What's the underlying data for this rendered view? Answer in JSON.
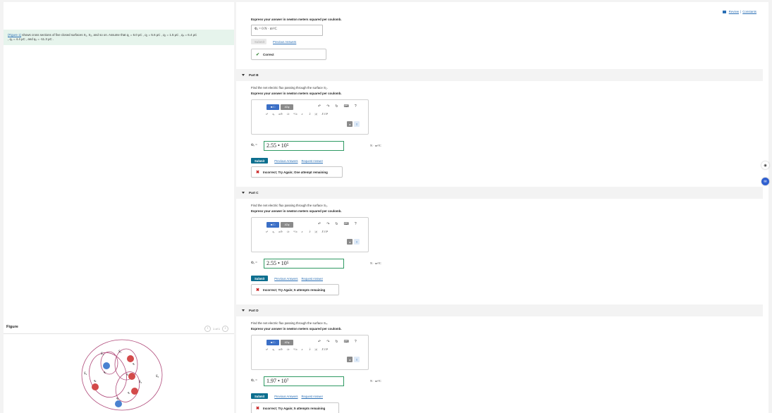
{
  "top_links": {
    "review": "Review",
    "separator": "|",
    "constants": "Constants"
  },
  "problem": {
    "link": "(Figure 1)",
    "text": " shows cross sections of five closed surfaces S₁, S₂, and so on. Assume that q₁ = 6.0 μC , q₂ = 5.6 μC , q₃ = 1.5 μC , q₄ = 6.4 μC",
    "text2": ", q₅ = 4.4 μC , and q₆ = -11.3 μC ."
  },
  "figure": {
    "label": "Figure",
    "pager": "1 of 1",
    "surfaces": [
      "S₁",
      "S₂",
      "S₃",
      "S₄",
      "S₅"
    ],
    "charges": [
      "q₁",
      "q₂",
      "q₃",
      "q₄",
      "q₅",
      "q₆"
    ]
  },
  "part_a": {
    "express": "Express your answer in newton meters squared per coulomb.",
    "answer": "Φₑ = 0  N · m²/C",
    "submit": "Submit",
    "previous": "Previous Answers",
    "feedback": "Correct"
  },
  "part_b": {
    "title": "Part B",
    "question": "Find the net electric flux passing through the surface S₂.",
    "express": "Express your answer in newton meters squared per coulomb.",
    "phi_label": "Φₑ =",
    "value": "2.55 • 10⁵",
    "unit": "N · m²/C",
    "submit": "Submit",
    "previous": "Previous Answers",
    "request": "Request Answer",
    "feedback": "Incorrect; Try Again; One attempt remaining"
  },
  "part_c": {
    "title": "Part C",
    "question": "Find the net electric flux passing through the surface S₃.",
    "express": "Express your answer in newton meters squared per coulomb.",
    "phi_label": "Φₑ =",
    "value": "2.55 • 10⁵",
    "unit": "N · m²/C",
    "submit": "Submit",
    "previous": "Previous Answers",
    "request": "Request Answer",
    "feedback": "Incorrect; Try Again; 5 attempts remaining"
  },
  "part_d": {
    "title": "Part D",
    "question": "Find the net electric flux passing through the surface S₄.",
    "express": "Express your answer in newton meters squared per coulomb.",
    "phi_label": "Φₑ =",
    "value": "1.97 • 10⁷",
    "unit": "N · m²/C",
    "submit": "Submit",
    "previous": "Previous Answers",
    "request": "Request Answer",
    "feedback": "Incorrect; Try Again; 5 attempts remaining"
  },
  "toolbar": {
    "templates": "■√□",
    "symbols": "ΑΣφ",
    "undo": "↶",
    "redo": "↷",
    "reset": "↻",
    "keyboard": "⌨",
    "help": "?",
    "row2": [
      "xᵃ",
      "xₐ",
      "a/b",
      "√x",
      "ⁿ√x",
      "x⃗",
      "x̂",
      "|x|",
      "X·10ⁿ"
    ]
  },
  "colors": {
    "submit": "#0d6f8f",
    "correct": "#3a8a3a",
    "incorrect": "#c81f1f",
    "link": "#2a6fb5",
    "problem_bg": "#e6f4ec"
  }
}
